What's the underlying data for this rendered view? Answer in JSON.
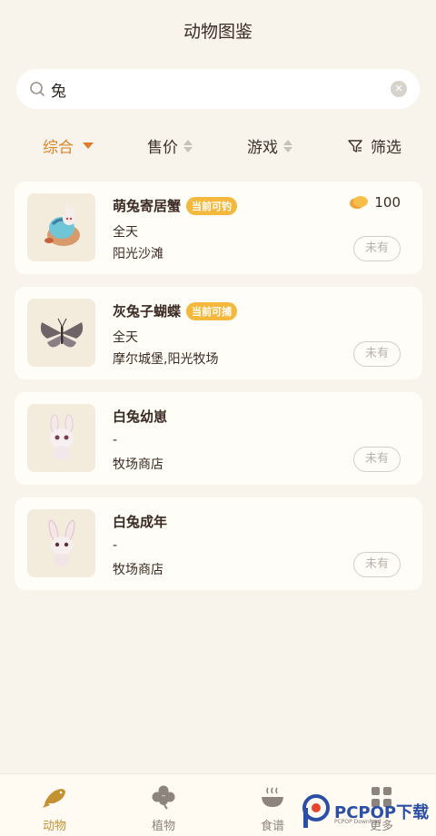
{
  "header": {
    "title": "动物图鉴"
  },
  "search": {
    "value": "兔",
    "clear_icon": "close-icon"
  },
  "filters": [
    {
      "label": "综合",
      "active": true
    },
    {
      "label": "售价"
    },
    {
      "label": "游戏"
    },
    {
      "label": "筛选"
    }
  ],
  "accent_color": "#d9852a",
  "badge_color": "#f4b93c",
  "items": [
    {
      "name": "萌兔寄居蟹",
      "badge": "当前可钓",
      "time": "全天",
      "place": "阳光沙滩",
      "price": "100",
      "owned": "未有"
    },
    {
      "name": "灰兔子蝴蝶",
      "badge": "当前可捕",
      "time": "全天",
      "place": "摩尔城堡,阳光牧场",
      "owned": "未有"
    },
    {
      "name": "白兔幼崽",
      "time": "-",
      "place": "牧场商店",
      "owned": "未有"
    },
    {
      "name": "白兔成年",
      "time": "-",
      "place": "牧场商店",
      "owned": "未有"
    }
  ],
  "tabbar": [
    {
      "label": "动物",
      "icon": "fish-icon",
      "active": true
    },
    {
      "label": "植物",
      "icon": "clover-icon"
    },
    {
      "label": "食谱",
      "icon": "bowl-icon"
    },
    {
      "label": "更多",
      "icon": "grid-icon"
    }
  ],
  "watermark": {
    "text": "PCPOP下载",
    "sub": "PCPOP Download"
  }
}
